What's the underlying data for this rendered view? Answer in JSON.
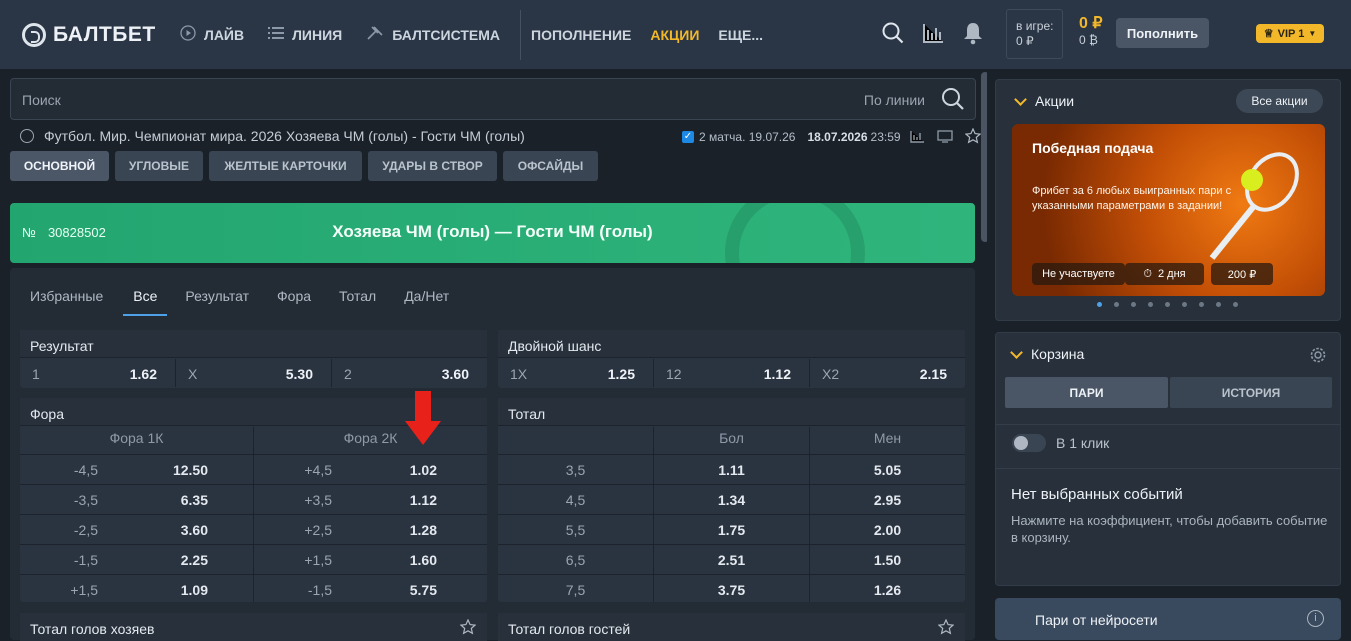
{
  "header": {
    "logo": "БАЛТБЕТ",
    "nav": [
      "ЛАЙВ",
      "ЛИНИЯ",
      "БАЛТСИСТЕМА"
    ],
    "nav2": [
      "ПОПОЛНЕНИЕ",
      "АКЦИИ",
      "ЕЩЕ..."
    ],
    "in_game_label": "в игре:",
    "in_game_value": "0 ₽",
    "balance_main": "0 ₽",
    "balance_bonus": "0 ₿",
    "deposit_label": "Пополнить",
    "vip_label": "VIP 1",
    "icons": [
      "search-icon",
      "stats-icon",
      "bell-icon"
    ]
  },
  "search": {
    "placeholder": "Поиск",
    "mode": "По линии"
  },
  "breadcrumb": "Футбол. Мир. Чемпионат мира. 2026  Хозяева ЧМ (голы) - Гости ЧМ (голы)",
  "match_meta": {
    "matches": "2 матча. 19.07.26",
    "date": "18.07.2026",
    "time": "23:59"
  },
  "market_tabs": [
    "ОСНОВНОЙ",
    "УГЛОВЫЕ",
    "ЖЕЛТЫЕ КАРТОЧКИ",
    "УДАРЫ В СТВОР",
    "ОФСАЙДЫ"
  ],
  "event": {
    "number_prefix": "№",
    "number": "30828502",
    "title": "Хозяева ЧМ (голы) — Гости ЧМ (голы)"
  },
  "filter_tabs": [
    "Избранные",
    "Все",
    "Результат",
    "Фора",
    "Тотал",
    "Да/Нет"
  ],
  "result": {
    "title": "Результат",
    "cells": [
      {
        "label": "1",
        "odd": "1.62"
      },
      {
        "label": "X",
        "odd": "5.30"
      },
      {
        "label": "2",
        "odd": "3.60"
      }
    ]
  },
  "double_chance": {
    "title": "Двойной шанс",
    "cells": [
      {
        "label": "1X",
        "odd": "1.25"
      },
      {
        "label": "12",
        "odd": "1.12"
      },
      {
        "label": "X2",
        "odd": "2.15"
      }
    ]
  },
  "handicap": {
    "title": "Фора",
    "col1": "Фора 1К",
    "col2": "Фора 2К",
    "rows": [
      {
        "h1": "-4,5",
        "o1": "12.50",
        "h2": "+4,5",
        "o2": "1.02"
      },
      {
        "h1": "-3,5",
        "o1": "6.35",
        "h2": "+3,5",
        "o2": "1.12"
      },
      {
        "h1": "-2,5",
        "o1": "3.60",
        "h2": "+2,5",
        "o2": "1.28"
      },
      {
        "h1": "-1,5",
        "o1": "2.25",
        "h2": "+1,5",
        "o2": "1.60"
      },
      {
        "h1": "+1,5",
        "o1": "1.09",
        "h2": "-1,5",
        "o2": "5.75"
      }
    ]
  },
  "total": {
    "title": "Тотал",
    "col_over": "Бол",
    "col_under": "Мен",
    "rows": [
      {
        "line": "3,5",
        "over": "1.11",
        "under": "5.05"
      },
      {
        "line": "4,5",
        "over": "1.34",
        "under": "2.95"
      },
      {
        "line": "5,5",
        "over": "1.75",
        "under": "2.00"
      },
      {
        "line": "6,5",
        "over": "2.51",
        "under": "1.50"
      },
      {
        "line": "7,5",
        "over": "3.75",
        "under": "1.26"
      }
    ]
  },
  "home_total_title": "Тотал голов хозяев",
  "away_total_title": "Тотал голов гостей",
  "promo": {
    "title": "Акции",
    "all_label": "Все акции",
    "card_title": "Победная подача",
    "card_desc": "Фрибет за 6 любых выигранных пари с указанными параметрами в задании!",
    "chip_status": "Не участвуете",
    "chip_days": "2 дня",
    "chip_amount": "200 ₽"
  },
  "cart": {
    "title": "Корзина",
    "tab_bets": "ПАРИ",
    "tab_history": "ИСТОРИЯ",
    "one_click": "В 1 клик",
    "empty_title": "Нет выбранных событий",
    "empty_desc": "Нажмите на коэффициент, чтобы добавить событие в корзину."
  },
  "ai_label": "Пари от нейросети",
  "colors": {
    "accent": "#f3b82a",
    "banner": "#2fb57c",
    "link": "#4ea1e6",
    "arrow": "#e8221b"
  }
}
